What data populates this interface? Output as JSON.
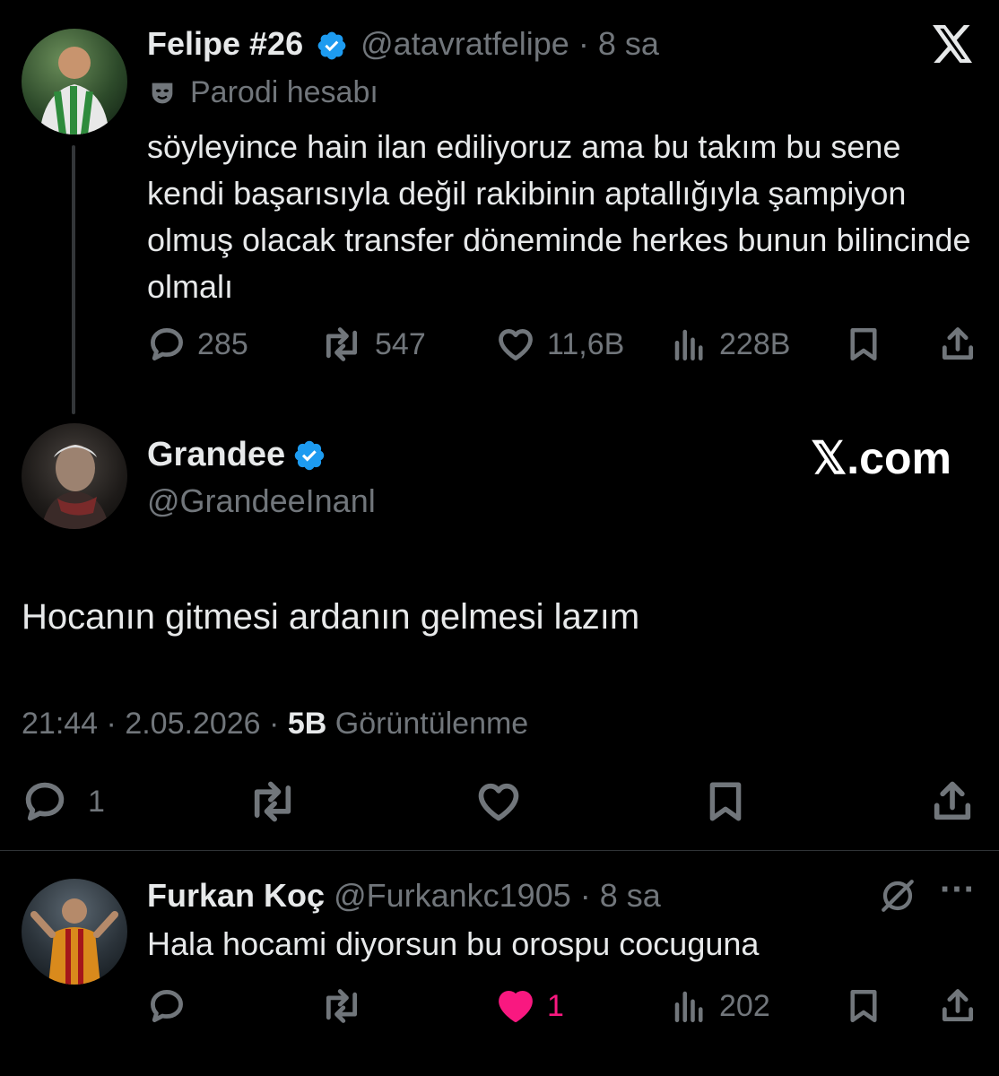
{
  "tweet1": {
    "display_name": "Felipe #26",
    "handle": "@atavratfelipe",
    "separator": "·",
    "time": "8 sa",
    "parody_label": "Parodi hesabı",
    "text": "söyleyince hain ilan ediliyoruz ama bu takım bu sene kendi başarısıyla değil rakibinin aptallığıyla şampiyon olmuş olacak transfer döneminde herkes bunun bilincinde olmalı",
    "actions": {
      "replies": "285",
      "reposts": "547",
      "likes": "11,6B",
      "views": "228B"
    }
  },
  "tweet2": {
    "display_name": "Grandee",
    "handle": "@GrandeeInanl",
    "watermark": "𝕏.com",
    "text": "Hocanın gitmesi ardanın gelmesi lazım",
    "time": "21:44",
    "date": "2.05.2026",
    "separator": "·",
    "views_count": "5B",
    "views_label": "Görüntülenme",
    "actions": {
      "replies": "1"
    }
  },
  "tweet3": {
    "display_name": "Furkan Koç",
    "handle": "@Furkankc1905",
    "separator": "·",
    "time": "8 sa",
    "more": "···",
    "text": "Hala hocami diyorsun bu orospu cocuguna",
    "actions": {
      "likes": "1",
      "views": "202"
    }
  },
  "logo": "X",
  "colors": {
    "background": "#000000",
    "text": "#e7e9ea",
    "muted": "#71767b",
    "verified": "#1d9bf0",
    "like_active": "#f91880"
  },
  "icons": [
    "x-logo-icon",
    "verified-badge-icon",
    "parody-mask-icon",
    "reply-icon",
    "repost-icon",
    "like-icon",
    "views-icon",
    "bookmark-icon",
    "share-icon",
    "grok-icon",
    "more-icon"
  ]
}
